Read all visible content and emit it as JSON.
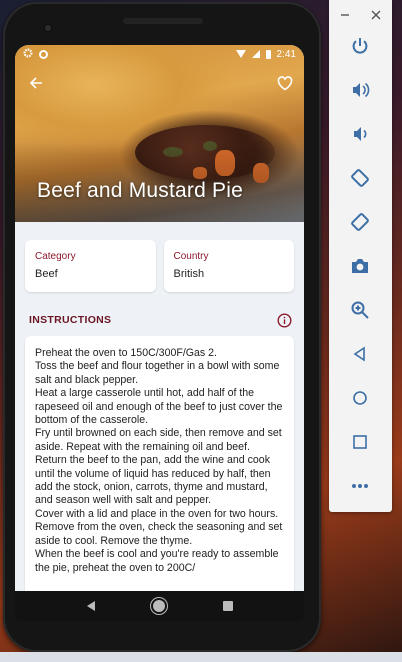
{
  "status_bar": {
    "time": "2:41",
    "icons": [
      "gear-icon",
      "circle-icon",
      "wifi-icon",
      "signal-icon",
      "battery-icon"
    ]
  },
  "hero": {
    "title": "Beef and Mustard Pie",
    "back_icon": "arrow-back-icon",
    "favorite_icon": "heart-outline-icon"
  },
  "details": {
    "category_label": "Category",
    "category_value": "Beef",
    "country_label": "Country",
    "country_value": "British"
  },
  "instructions": {
    "heading": "INSTRUCTIONS",
    "info_icon": "info-icon",
    "text": "Preheat the oven to 150C/300F/Gas 2.\nToss the beef and flour together in a bowl with some salt and black pepper.\nHeat a large casserole until hot, add half of the rapeseed oil and enough of the beef to just cover the bottom of the casserole.\nFry until browned on each side, then remove and set aside. Repeat with the remaining oil and beef.\nReturn the beef to the pan, add the wine and cook until the volume of liquid has reduced by half, then add the stock, onion, carrots, thyme and mustard, and season well with salt and pepper.\nCover with a lid and place in the oven for two hours.\nRemove from the oven, check the seasoning and set aside to cool. Remove the thyme.\nWhen the beef is cool and you're ready to assemble the pie, preheat the oven to 200C/"
  },
  "nav_bar": {
    "icons": [
      "nav-back-icon",
      "nav-home-icon",
      "nav-recents-icon"
    ]
  },
  "emulator_toolbar": {
    "top_icons": [
      "minimize-icon",
      "close-icon"
    ],
    "buttons": [
      "power-icon",
      "volume-up-icon",
      "volume-down-icon",
      "rotate-left-icon",
      "rotate-right-icon",
      "camera-icon",
      "zoom-icon",
      "back-icon",
      "home-icon",
      "overview-icon",
      "more-icon"
    ]
  },
  "colors": {
    "accent": "#8b1a2b",
    "screen_bg": "#eef2f6",
    "toolbar_icon": "#3d6fa6"
  }
}
